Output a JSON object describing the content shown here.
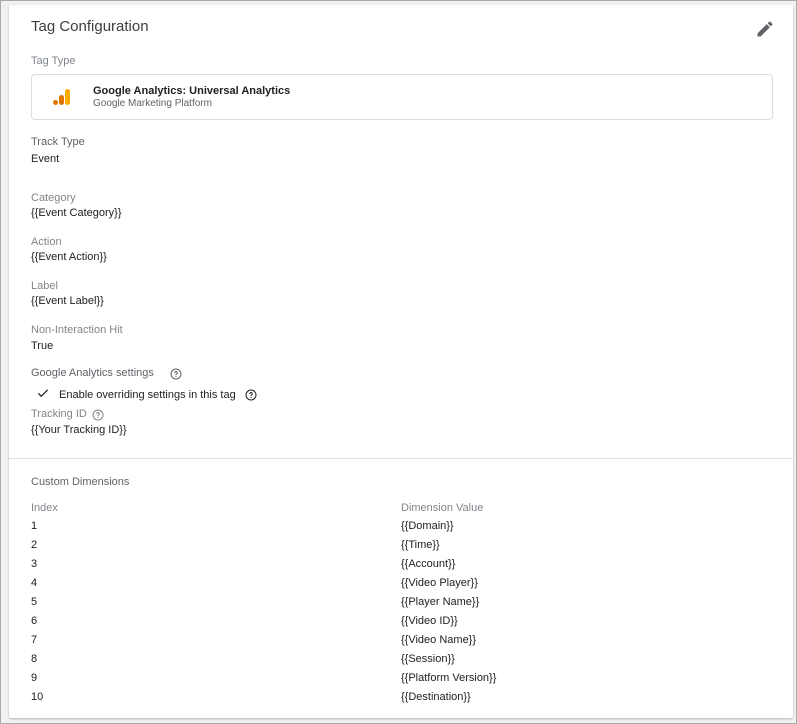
{
  "card": {
    "title": "Tag Configuration",
    "edit_icon": "pencil-icon"
  },
  "tag_type": {
    "label": "Tag Type",
    "name": "Google Analytics: Universal Analytics",
    "platform": "Google Marketing Platform",
    "icon": "google-analytics-icon",
    "icon_colors": [
      "#f9ab00",
      "#e37400"
    ]
  },
  "fields": {
    "track_type": {
      "label": "Track Type",
      "value": "Event"
    },
    "category": {
      "label": "Category",
      "value": "{{Event Category}}"
    },
    "action": {
      "label": "Action",
      "value": "{{Event Action}}"
    },
    "event_label": {
      "label": "Label",
      "value": "{{Event Label}}"
    },
    "non_interaction": {
      "label": "Non-Interaction Hit",
      "value": "True"
    }
  },
  "ga_settings": {
    "label": "Google Analytics settings",
    "help_icon": "help-circle-icon",
    "override_label": "Enable overriding settings in this tag",
    "override_checked": true,
    "tracking_id_label": "Tracking ID",
    "tracking_id_value": "{{Your Tracking ID}}"
  },
  "custom_dimensions": {
    "heading": "Custom Dimensions",
    "col_index": "Index",
    "col_value": "Dimension Value",
    "rows": [
      {
        "index": "1",
        "value": "{{Domain}}"
      },
      {
        "index": "2",
        "value": "{{Time}}"
      },
      {
        "index": "3",
        "value": "{{Account}}"
      },
      {
        "index": "4",
        "value": "{{Video Player}}"
      },
      {
        "index": "5",
        "value": "{{Player Name}}"
      },
      {
        "index": "6",
        "value": "{{Video ID}}"
      },
      {
        "index": "7",
        "value": "{{Video Name}}"
      },
      {
        "index": "8",
        "value": "{{Session}}"
      },
      {
        "index": "9",
        "value": "{{Platform Version}}"
      },
      {
        "index": "10",
        "value": "{{Destination}}"
      }
    ]
  }
}
